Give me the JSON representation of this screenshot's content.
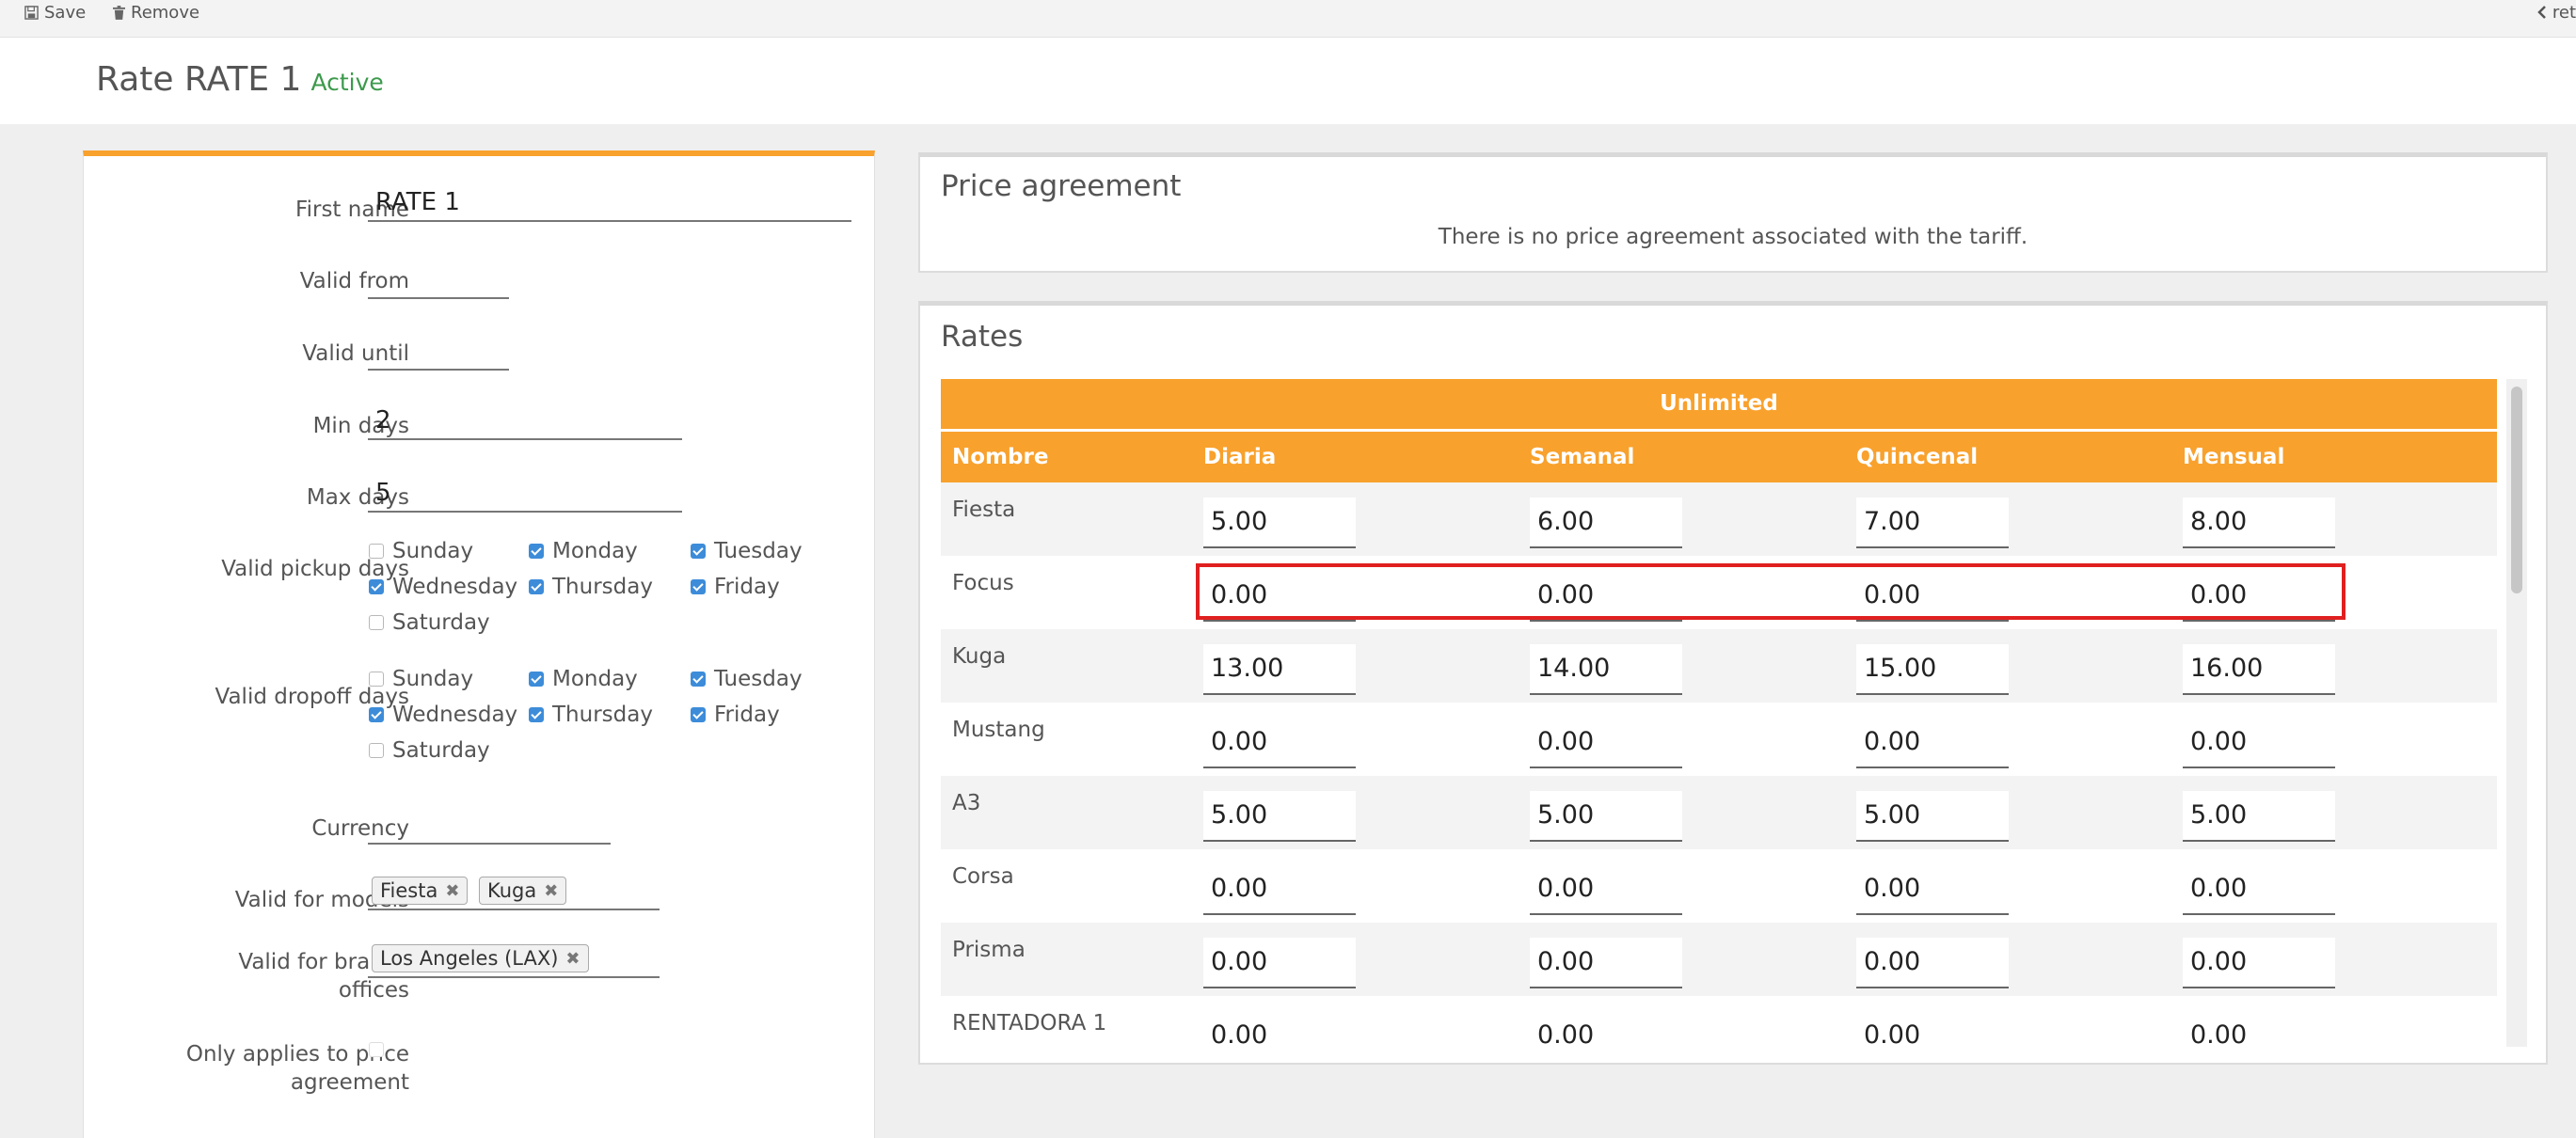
{
  "toolbar": {
    "save": "Save",
    "remove": "Remove",
    "return": "ret"
  },
  "header": {
    "title": "Rate RATE 1",
    "status": "Active"
  },
  "form": {
    "first_name_label": "First name",
    "first_name_value": "RATE 1",
    "valid_from_label": "Valid from",
    "valid_until_label": "Valid until",
    "min_days_label": "Min days",
    "min_days_value": "2",
    "max_days_label": "Max days",
    "max_days_value": "5",
    "pickup_label": "Valid pickup days",
    "dropoff_label": "Valid dropoff days",
    "days": [
      "Sunday",
      "Monday",
      "Tuesday",
      "Wednesday",
      "Thursday",
      "Friday",
      "Saturday"
    ],
    "pickup_checked": [
      false,
      true,
      true,
      true,
      true,
      true,
      false
    ],
    "dropoff_checked": [
      false,
      true,
      true,
      true,
      true,
      true,
      false
    ],
    "currency_label": "Currency",
    "models_label": "Valid for models",
    "models_tags": [
      "Fiesta",
      "Kuga"
    ],
    "branch_label_1": "Valid for branch",
    "branch_label_2": "offices",
    "branch_tags": [
      "Los Angeles (LAX)"
    ],
    "only_applies_label_1": "Only applies to price",
    "only_applies_label_2": "agreement",
    "only_applies_checked": false
  },
  "price_agreement": {
    "title": "Price agreement",
    "message": "There is no price agreement associated with the tariff."
  },
  "rates": {
    "title": "Rates",
    "group_header": "Unlimited",
    "columns": [
      "Nombre",
      "Diaria",
      "Semanal",
      "Quincenal",
      "Mensual"
    ],
    "rows": [
      {
        "model": "Fiesta",
        "values": [
          "5.00",
          "6.00",
          "7.00",
          "8.00"
        ]
      },
      {
        "model": "Focus",
        "values": [
          "0.00",
          "0.00",
          "0.00",
          "0.00"
        ]
      },
      {
        "model": "Kuga",
        "values": [
          "13.00",
          "14.00",
          "15.00",
          "16.00"
        ]
      },
      {
        "model": "Mustang",
        "values": [
          "0.00",
          "0.00",
          "0.00",
          "0.00"
        ]
      },
      {
        "model": "A3",
        "values": [
          "5.00",
          "5.00",
          "5.00",
          "5.00"
        ]
      },
      {
        "model": "Corsa",
        "values": [
          "0.00",
          "0.00",
          "0.00",
          "0.00"
        ]
      },
      {
        "model": "Prisma",
        "values": [
          "0.00",
          "0.00",
          "0.00",
          "0.00"
        ]
      },
      {
        "model": "RENTADORA 1",
        "values": [
          "0.00",
          "0.00",
          "0.00",
          "0.00"
        ]
      }
    ]
  },
  "colors": {
    "accent": "#f8a12d",
    "status": "#3c9a4c",
    "checkbox": "#3d8cd9",
    "highlight": "#e02020"
  }
}
